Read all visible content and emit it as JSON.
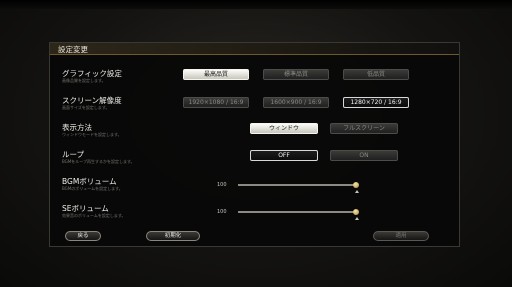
{
  "header": {
    "title": "設定変更"
  },
  "rows": {
    "graphic": {
      "title": "グラフィック設定",
      "desc": "画像品質を設定します。",
      "options": [
        "最高品質",
        "標準品質",
        "低品質"
      ]
    },
    "resolution": {
      "title": "スクリーン解像度",
      "desc": "画面サイズを設定します。",
      "options": [
        "1920×1080 / 16:9",
        "1600×900 / 16:9",
        "1280×720 / 16:9"
      ]
    },
    "display": {
      "title": "表示方法",
      "desc": "ウィンドウモードを設定します。",
      "options": [
        "ウィンドウ",
        "フルスクリーン"
      ]
    },
    "loop": {
      "title": "ループ",
      "desc": "BGMをループ再生するかを設定します。",
      "options": [
        "OFF",
        "ON"
      ]
    },
    "bgm": {
      "title": "BGMボリューム",
      "desc": "BGMのボリュームを設定します。",
      "value": "100",
      "level": 1.0
    },
    "se": {
      "title": "SEボリューム",
      "desc": "効果音のボリュームを設定します。",
      "value": "100",
      "level": 1.0
    }
  },
  "footer": {
    "back": "戻る",
    "reset": "初期化",
    "apply": "適用"
  },
  "colors": {
    "accent": "#6e5a28",
    "selected": "#f6f4ec",
    "knob": "#d8b868"
  }
}
